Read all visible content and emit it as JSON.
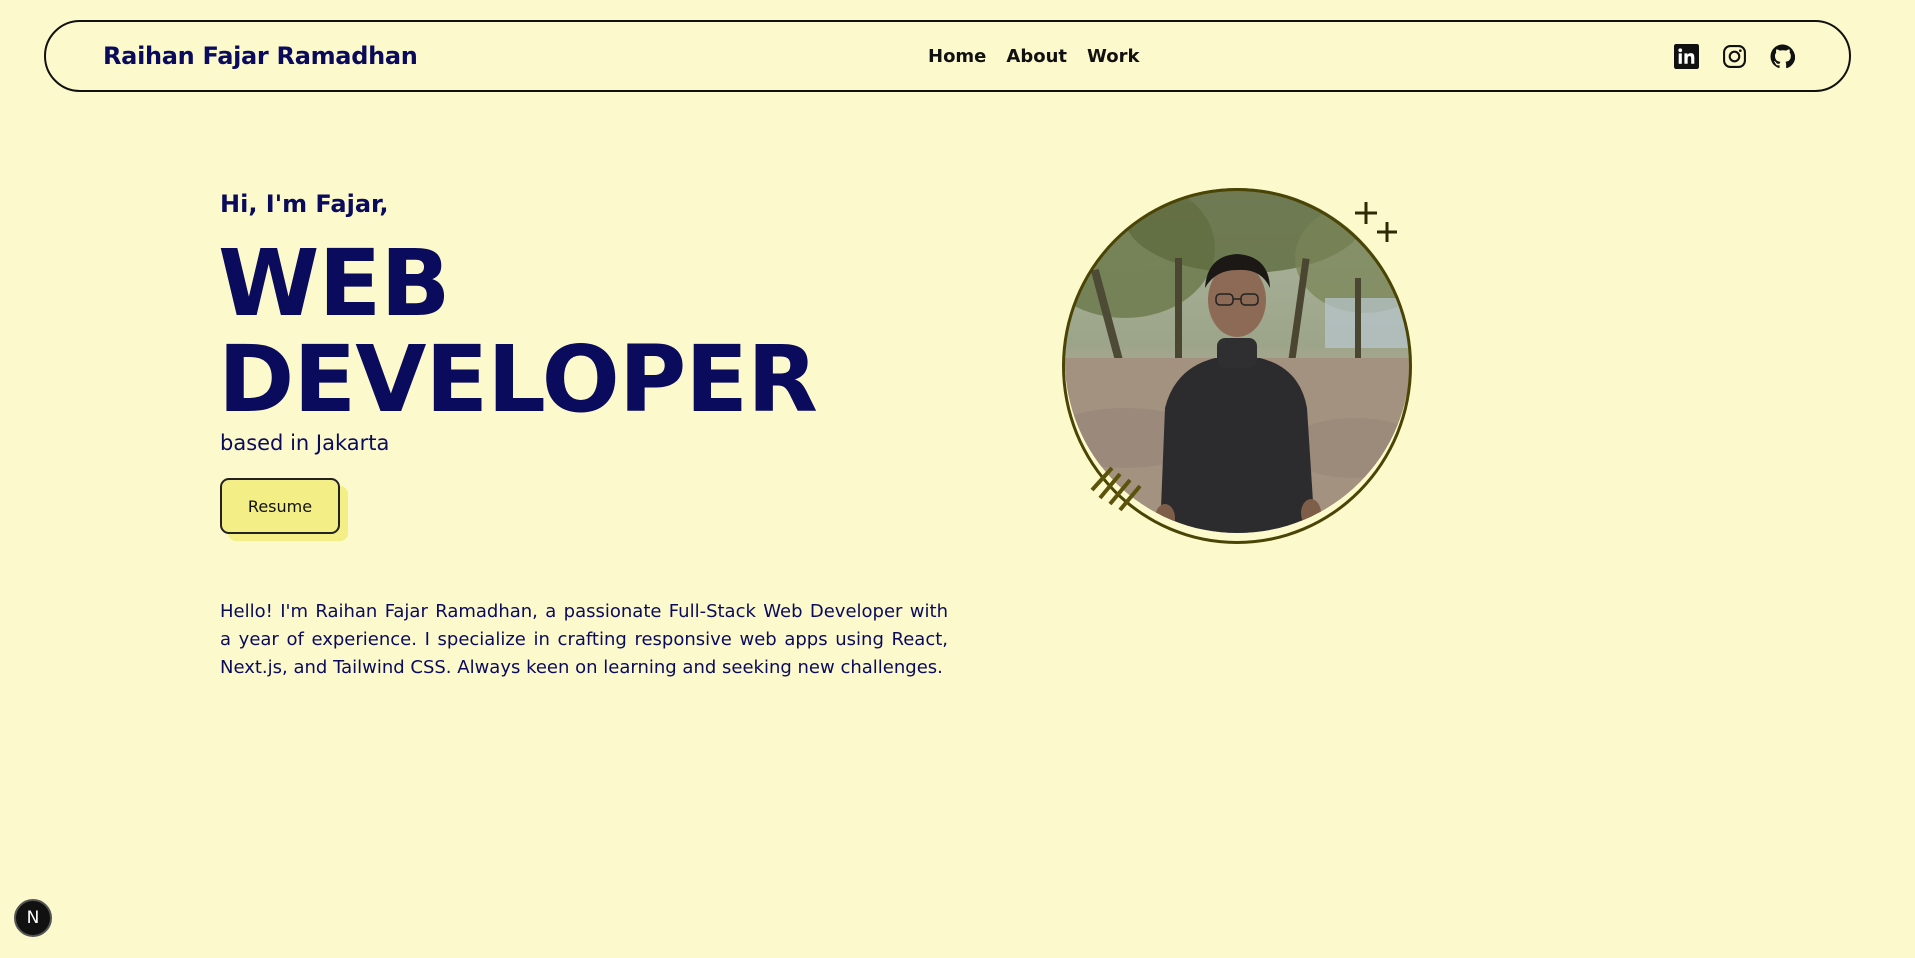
{
  "navbar": {
    "brand": "Raihan Fajar Ramadhan",
    "links": [
      {
        "label": "Home"
      },
      {
        "label": "About"
      },
      {
        "label": "Work"
      }
    ],
    "socials": [
      "linkedin-icon",
      "instagram-icon",
      "github-icon"
    ]
  },
  "hero": {
    "greeting": "Hi, I'm Fajar,",
    "headline_line1": "WEB",
    "headline_line2": "DEVELOPER",
    "location": "based in Jakarta",
    "resume_label": "Resume",
    "bio": "Hello! I'm Raihan Fajar Ramadhan, a passionate Full-Stack Web Developer with a year of experience. I specialize in crafting responsive web apps using React, Next.js, and Tailwind CSS. Always keen on learning and seeking new challenges."
  },
  "dev_badge": {
    "label": "N"
  },
  "colors": {
    "background": "#fcf9cc",
    "navy": "#0a0b5c",
    "accent_yellow": "#f4ee86",
    "ring": "#4a4405"
  }
}
